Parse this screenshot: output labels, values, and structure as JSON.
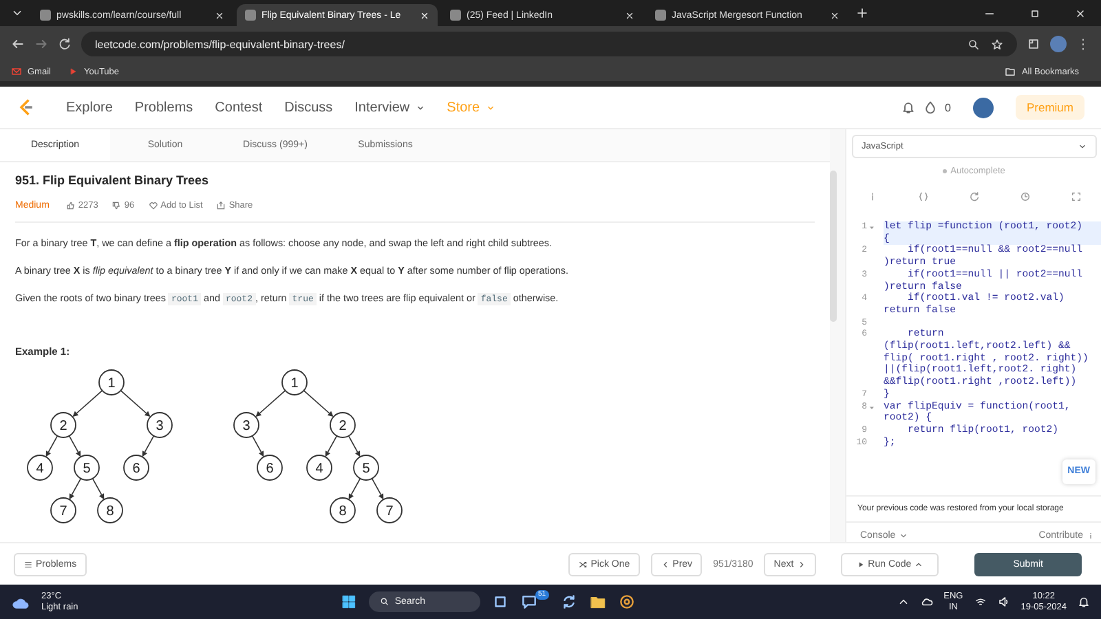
{
  "browser": {
    "tabs": [
      {
        "title": "pwskills.com/learn/course/full",
        "selected": false
      },
      {
        "title": "Flip Equivalent Binary Trees - Le",
        "selected": true
      },
      {
        "title": "(25) Feed | LinkedIn",
        "selected": false
      },
      {
        "title": "JavaScript Mergesort Function",
        "selected": false
      }
    ],
    "address": "leetcode.com/problems/flip-equivalent-binary-trees/",
    "bookmarks": [
      {
        "label": "Gmail",
        "kind": "mail"
      },
      {
        "label": "YouTube",
        "kind": "video"
      }
    ],
    "all_bookmarks": "All Bookmarks"
  },
  "nav": {
    "items": [
      {
        "label": "Explore",
        "kind": "plain"
      },
      {
        "label": "Problems",
        "kind": "plain"
      },
      {
        "label": "Contest",
        "kind": "plain"
      },
      {
        "label": "Discuss",
        "kind": "plain"
      },
      {
        "label": "Interview",
        "kind": "dropdown"
      },
      {
        "label": "Store",
        "kind": "store"
      }
    ],
    "coins": "0",
    "premium": "Premium"
  },
  "left_tabs": [
    {
      "label": "Description",
      "selected": true
    },
    {
      "label": "Solution",
      "selected": false
    },
    {
      "label": "Discuss (999+)",
      "selected": false
    },
    {
      "label": "Submissions",
      "selected": false
    }
  ],
  "problem": {
    "title": "951. Flip Equivalent Binary Trees",
    "difficulty": "Medium",
    "likes": "2273",
    "dislikes": "96",
    "add_to_list": "Add to List",
    "share": "Share",
    "paragraphs": [
      [
        {
          "kind": "text",
          "text": "For a binary tree "
        },
        {
          "kind": "bold",
          "text": "T"
        },
        {
          "kind": "text",
          "text": ", we can define a "
        },
        {
          "kind": "bold",
          "text": "flip operation"
        },
        {
          "kind": "text",
          "text": " as follows: choose any node, and swap the left and right child subtrees."
        }
      ],
      [
        {
          "kind": "text",
          "text": "A binary tree "
        },
        {
          "kind": "bold",
          "text": "X"
        },
        {
          "kind": "text",
          "text": " is "
        },
        {
          "kind": "italic",
          "text": "flip equivalent"
        },
        {
          "kind": "text",
          "text": " to a binary tree "
        },
        {
          "kind": "bold",
          "text": "Y"
        },
        {
          "kind": "text",
          "text": " if and only if we can make "
        },
        {
          "kind": "bold",
          "text": "X"
        },
        {
          "kind": "text",
          "text": " equal to "
        },
        {
          "kind": "bold",
          "text": "Y"
        },
        {
          "kind": "text",
          "text": " after some number of flip operations."
        }
      ],
      [
        {
          "kind": "text",
          "text": "Given the roots of two binary trees "
        },
        {
          "kind": "code",
          "text": "root1"
        },
        {
          "kind": "text",
          "text": " and "
        },
        {
          "kind": "code",
          "text": "root2"
        },
        {
          "kind": "text",
          "text": ", return "
        },
        {
          "kind": "code",
          "text": "true"
        },
        {
          "kind": "text",
          "text": " if the two trees are flip equivalent or "
        },
        {
          "kind": "code",
          "text": "false"
        },
        {
          "kind": "text",
          "text": " otherwise."
        }
      ]
    ],
    "example_heading": "Example 1:",
    "trees": [
      {
        "value": "1",
        "children": [
          {
            "value": "2",
            "kind": "left",
            "children": [
              {
                "value": "4",
                "kind": "left"
              },
              {
                "value": "5",
                "kind": "right",
                "children": [
                  {
                    "value": "7",
                    "kind": "left"
                  },
                  {
                    "value": "8",
                    "kind": "right"
                  }
                ]
              }
            ]
          },
          {
            "value": "3",
            "kind": "right",
            "children": [
              {
                "value": "6",
                "kind": "left"
              }
            ]
          }
        ]
      },
      {
        "value": "1",
        "children": [
          {
            "value": "3",
            "kind": "left",
            "children": [
              {
                "value": "6",
                "kind": "right"
              }
            ]
          },
          {
            "value": "2",
            "kind": "right",
            "children": [
              {
                "value": "4",
                "kind": "left"
              },
              {
                "value": "5",
                "kind": "right",
                "children": [
                  {
                    "value": "8",
                    "kind": "left"
                  },
                  {
                    "value": "7",
                    "kind": "right"
                  }
                ]
              }
            ]
          }
        ]
      }
    ]
  },
  "editor": {
    "language": "JavaScript",
    "autocomplete": "Autocomplete",
    "lines": [
      {
        "number": "1",
        "foldable": true,
        "current": true,
        "segments": [
          "let flip =function (root1, root2)",
          "{"
        ]
      },
      {
        "number": "2",
        "foldable": false,
        "current": false,
        "segments": [
          "    if(root1==null && root2==null",
          ")return true"
        ]
      },
      {
        "number": "3",
        "foldable": false,
        "current": false,
        "segments": [
          "    if(root1==null || root2==null",
          ")return false"
        ]
      },
      {
        "number": "4",
        "foldable": false,
        "current": false,
        "segments": [
          "    if(root1.val != root2.val)",
          "return false"
        ]
      },
      {
        "number": "5",
        "foldable": false,
        "current": false
      },
      {
        "number": "6",
        "foldable": false,
        "current": false,
        "segments": [
          "    return",
          "(flip(root1.left,root2.left) &&",
          "flip( root1.right , root2. right))",
          "||(flip(root1.left,root2. right)",
          "&&flip(root1.right ,root2.left))"
        ]
      },
      {
        "number": "7",
        "foldable": false,
        "current": false,
        "segments": [
          "}"
        ]
      },
      {
        "number": "8",
        "foldable": true,
        "current": false,
        "segments": [
          "var flipEquiv = function(root1,",
          "root2) {"
        ]
      },
      {
        "number": "9",
        "foldable": false,
        "current": false,
        "segments": [
          "    return flip(root1, root2)"
        ]
      },
      {
        "number": "10",
        "foldable": false,
        "current": false,
        "segments": [
          "};"
        ]
      }
    ],
    "new_badge": "NEW",
    "restored": "Your previous code was restored from your local storage",
    "console": "Console",
    "contribute": "Contribute",
    "run": "Run Code",
    "submit": "Submit"
  },
  "bottom": {
    "problems": "Problems",
    "pick_one": "Pick One",
    "prev": "Prev",
    "counter": "951/3180",
    "next": "Next"
  },
  "taskbar": {
    "temperature": "23°C",
    "weather": "Light rain",
    "search": "Search",
    "badge": "51",
    "lang": "ENG",
    "region": "IN",
    "time": "10:22",
    "date": "19-05-2024"
  }
}
